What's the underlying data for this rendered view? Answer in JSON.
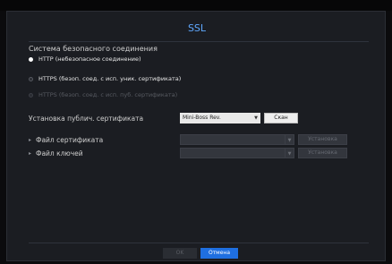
{
  "dialog": {
    "title": "SSL",
    "section_label": "Система безопасного соединения",
    "options": [
      {
        "label": "HTTP (небезопасное соединение)",
        "state": "checked"
      },
      {
        "label": "HTTPS (безоп. соед. с исп. уник. сертификата)",
        "state": "unchecked"
      },
      {
        "label": "HTTPS (безоп. соед. с исп. пуб. сертификата)",
        "state": "disabled"
      }
    ],
    "install_public_cert": {
      "label": "Установка публич. сертификата",
      "select_value": "Mini-Boss Rev.",
      "scan_button": "Скан"
    },
    "cert_file": {
      "label": "Файл сертификата",
      "install_button": "Установка"
    },
    "key_file": {
      "label": "Файл ключей",
      "install_button": "Установка"
    },
    "footer": {
      "ok_button": "OK",
      "cancel_button": "Отмена"
    }
  },
  "colors": {
    "accent": "#5fa8ff",
    "primary_button": "#1f6fe0",
    "panel_bg": "#1b1d22"
  },
  "icons": {
    "bullet": "triangle-right-icon",
    "dropdown": "triangle-down-icon"
  }
}
